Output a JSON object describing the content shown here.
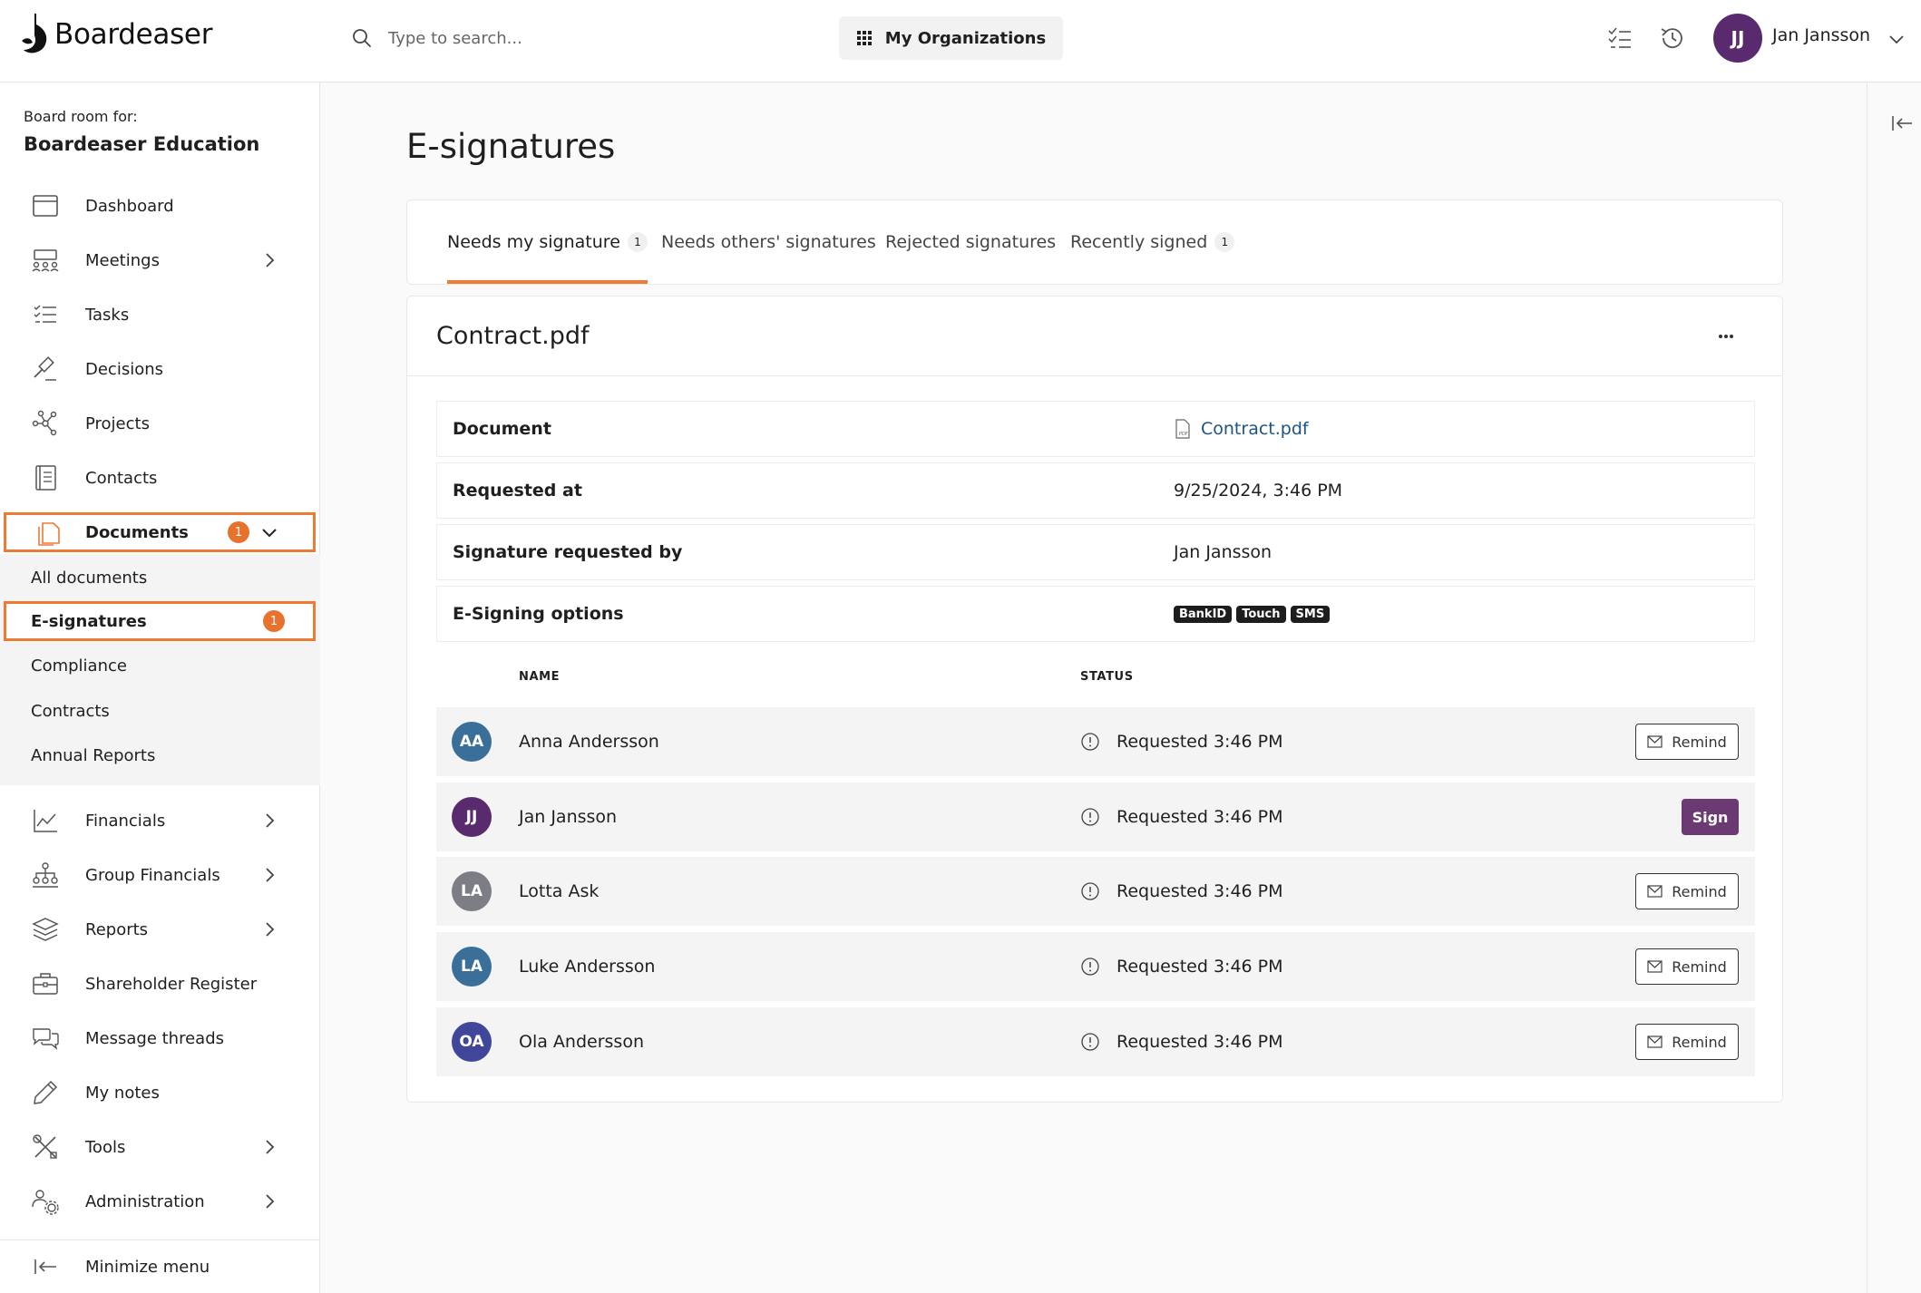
{
  "header": {
    "logo_text": "Boardeaser",
    "search_placeholder": "Type to search...",
    "org_button_label": "My Organizations",
    "user": {
      "initials": "JJ",
      "name": "Jan Jansson",
      "avatar_color": "#5a2a6e"
    }
  },
  "sidebar": {
    "board_for_label": "Board room for:",
    "board_name": "Boardeaser Education",
    "items_top": [
      {
        "label": "Dashboard",
        "icon": "calendar-icon",
        "has_chevron": false
      },
      {
        "label": "Meetings",
        "icon": "meeting-people-icon",
        "has_chevron": true
      },
      {
        "label": "Tasks",
        "icon": "checklist-icon",
        "has_chevron": false
      },
      {
        "label": "Decisions",
        "icon": "gavel-icon",
        "has_chevron": false
      },
      {
        "label": "Projects",
        "icon": "network-nodes-icon",
        "has_chevron": false
      },
      {
        "label": "Contacts",
        "icon": "address-book-icon",
        "has_chevron": false
      }
    ],
    "documents": {
      "label": "Documents",
      "count": "1",
      "icon": "documents-icon",
      "expanded": true
    },
    "documents_sub": [
      {
        "label": "All documents"
      },
      {
        "label": "E-signatures",
        "count": "1",
        "active": true
      },
      {
        "label": "Compliance"
      },
      {
        "label": "Contracts"
      },
      {
        "label": "Annual Reports"
      }
    ],
    "items_bottom": [
      {
        "label": "Financials",
        "icon": "line-chart-icon",
        "has_chevron": true
      },
      {
        "label": "Group Financials",
        "icon": "org-hierarchy-icon",
        "has_chevron": true
      },
      {
        "label": "Reports",
        "icon": "layers-icon",
        "has_chevron": true
      },
      {
        "label": "Shareholder Register",
        "icon": "briefcase-icon",
        "has_chevron": false
      },
      {
        "label": "Message threads",
        "icon": "chat-bubbles-icon",
        "has_chevron": false
      },
      {
        "label": "My notes",
        "icon": "pencil-icon",
        "has_chevron": false
      },
      {
        "label": "Tools",
        "icon": "tools-icon",
        "has_chevron": true
      },
      {
        "label": "Administration",
        "icon": "users-gear-icon",
        "has_chevron": true
      }
    ],
    "minimize_label": "Minimize menu"
  },
  "main": {
    "title": "E-signatures",
    "tabs": [
      {
        "label": "Needs my signature",
        "count": "1",
        "active": true
      },
      {
        "label": "Needs others' signatures",
        "count": ""
      },
      {
        "label": "Rejected signatures",
        "count": ""
      },
      {
        "label": "Recently signed",
        "count": "1"
      }
    ],
    "document": {
      "title": "Contract.pdf",
      "info": [
        {
          "label": "Document",
          "value": "Contract.pdf"
        },
        {
          "label": "Requested at",
          "value": "9/25/2024, 3:46 PM"
        },
        {
          "label": "Signature requested by",
          "value": "Jan Jansson"
        },
        {
          "label": "E-Signing options",
          "value": ""
        }
      ],
      "signing_options": [
        "BankID",
        "Touch",
        "SMS"
      ],
      "columns": {
        "name": "NAME",
        "status": "STATUS"
      },
      "signers": [
        {
          "initials": "AA",
          "name": "Anna Andersson",
          "status": "Requested 3:46 PM",
          "action": "Remind",
          "color": "#3a6f9a"
        },
        {
          "initials": "JJ",
          "name": "Jan Jansson",
          "status": "Requested 3:46 PM",
          "action": "Sign",
          "color": "#5a2a6e"
        },
        {
          "initials": "LA",
          "name": "Lotta Ask",
          "status": "Requested 3:46 PM",
          "action": "Remind",
          "color": "#7d7d85"
        },
        {
          "initials": "LA",
          "name": "Luke Andersson",
          "status": "Requested 3:46 PM",
          "action": "Remind",
          "color": "#3a6f9a"
        },
        {
          "initials": "OA",
          "name": "Ola Andersson",
          "status": "Requested 3:46 PM",
          "action": "Remind",
          "color": "#40479a"
        }
      ]
    }
  },
  "colors": {
    "accent": "#ed7a35",
    "badge": "#e6722e",
    "sign_button": "#6b3a73",
    "link": "#1b5486"
  }
}
